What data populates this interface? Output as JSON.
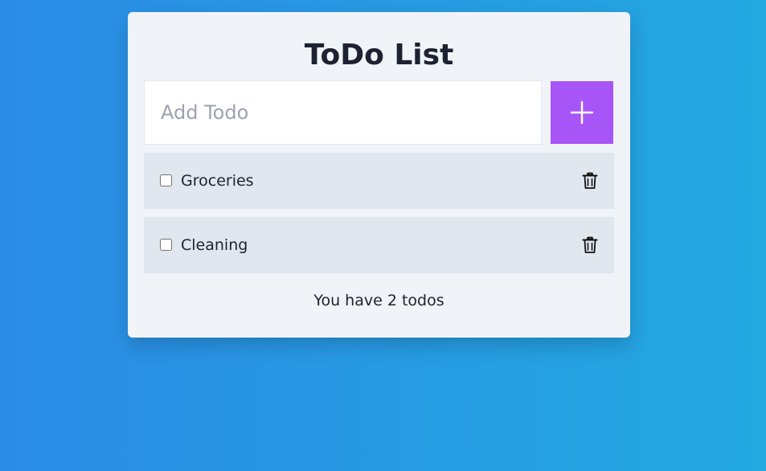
{
  "app": {
    "title": "ToDo List"
  },
  "input": {
    "placeholder": "Add Todo",
    "value": ""
  },
  "add_button": {
    "icon": "plus-icon"
  },
  "todos": [
    {
      "label": "Groceries",
      "checked": false
    },
    {
      "label": "Cleaning",
      "checked": false
    }
  ],
  "footer": {
    "count_text": "You have 2 todos"
  },
  "colors": {
    "background_start": "#2b8ce6",
    "background_end": "#23a8e0",
    "card": "#f0f3f8",
    "item": "#e1e7ef",
    "accent": "#a855f7",
    "text": "#1c2230"
  }
}
